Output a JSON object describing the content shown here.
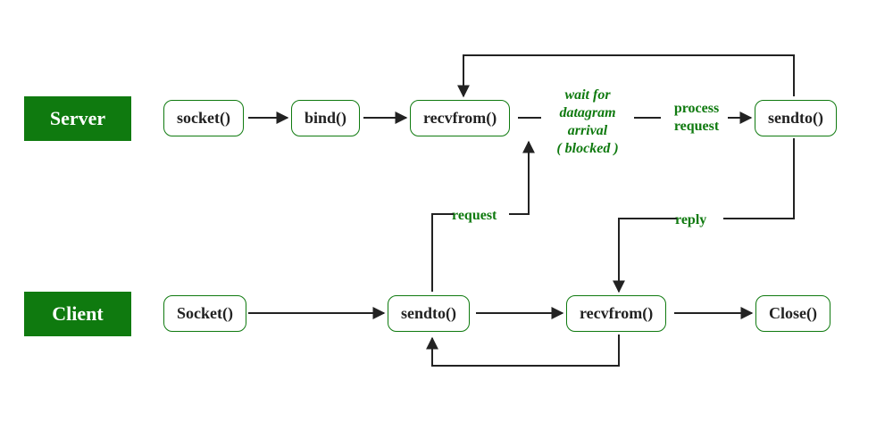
{
  "roles": {
    "server": "Server",
    "client": "Client"
  },
  "server_nodes": {
    "socket": "socket()",
    "bind": "bind()",
    "recvfrom": "recvfrom()",
    "sendto": "sendto()"
  },
  "client_nodes": {
    "socket": "Socket()",
    "sendto": "sendto()",
    "recvfrom": "recvfrom()",
    "close": "Close()"
  },
  "labels": {
    "wait_line1": "wait for",
    "wait_line2": "datagram",
    "wait_line3": "arrival",
    "wait_line4": "( blocked )",
    "process_line1": "process",
    "process_line2": "request",
    "request": "request",
    "reply": "reply"
  }
}
